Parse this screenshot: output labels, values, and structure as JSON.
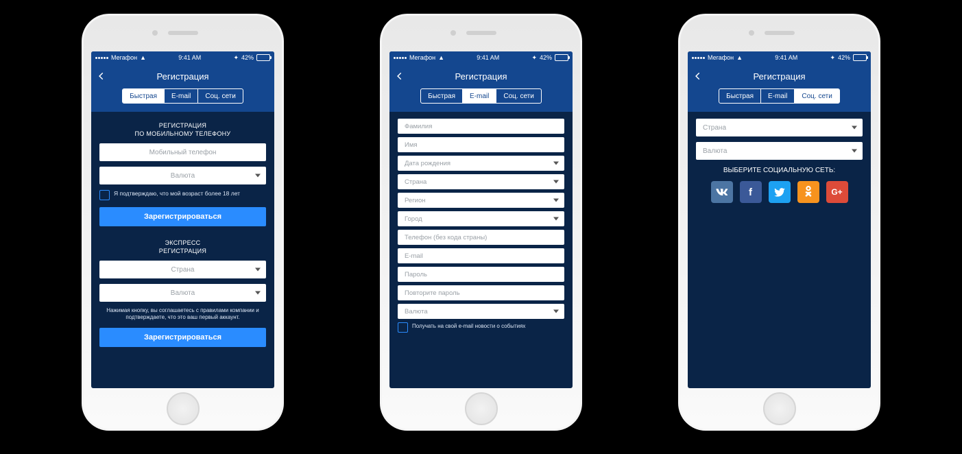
{
  "statusbar": {
    "carrier": "Мегафон",
    "time": "9:41 AM",
    "battery_pct": "42%"
  },
  "navbar": {
    "title": "Регистрация"
  },
  "tabs": {
    "quick": "Быстрая",
    "email": "E-mail",
    "social": "Соц. сети"
  },
  "screen1": {
    "section1_line1": "РЕГИСТРАЦИЯ",
    "section1_line2": "ПО МОБИЛЬНОМУ ТЕЛЕФОНУ",
    "phone_ph": "Мобильный телефон",
    "currency_ph": "Валюта",
    "age_confirm": "Я подтверждаю, что мой возраст более 18 лет",
    "register_btn": "Зарегистрироваться",
    "section2_line1": "ЭКСПРЕСС",
    "section2_line2": "РЕГИСТРАЦИЯ",
    "country_ph": "Страна",
    "disclaimer": "Нажимая кнопку, вы соглашаетесь с правилами компании и подтверждаете, что это ваш первый аккаунт."
  },
  "screen2": {
    "lastname_ph": "Фамилия",
    "firstname_ph": "Имя",
    "dob_ph": "Дата рождения",
    "country_ph": "Страна",
    "region_ph": "Регион",
    "city_ph": "Город",
    "phone_ph": "Телефон (без кода страны)",
    "email_ph": "E-mail",
    "password_ph": "Пароль",
    "password2_ph": "Повторите пароль",
    "currency_ph": "Валюта",
    "news_check": "Получать на свой e-mail новости о событиях"
  },
  "screen3": {
    "country_ph": "Страна",
    "currency_ph": "Валюта",
    "social_title": "ВЫБЕРИТЕ СОЦИАЛЬНУЮ СЕТЬ:",
    "networks": {
      "vk": "VK",
      "fb": "Facebook",
      "tw": "Twitter",
      "ok": "Odnoklassniki",
      "gp": "Google+"
    }
  }
}
